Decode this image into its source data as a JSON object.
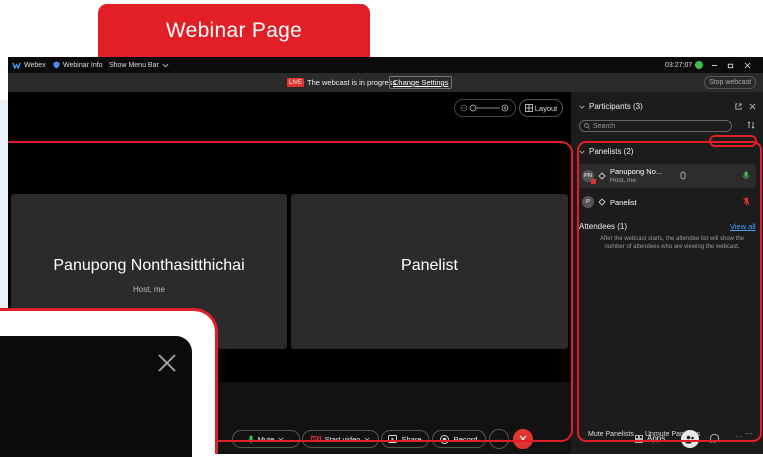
{
  "banner": {
    "title": "Webinar Page"
  },
  "titlebar": {
    "app_name": "Webex",
    "webinar_info": "Webinar Info",
    "show_menu_bar": "Show Menu Bar",
    "time": "03:27:07"
  },
  "infobar": {
    "live_badge": "LIVE",
    "status_text": "The webcast is in progress.",
    "change_settings": "Change Settings",
    "stop_webcast": "Stop webcast"
  },
  "stage": {
    "layout_label": "Layout",
    "tiles": [
      {
        "name": "Panupong Nonthasitthichai",
        "subtitle": "Host, me"
      },
      {
        "name": "Panelist",
        "subtitle": ""
      }
    ]
  },
  "panel": {
    "title": "Participants (3)",
    "search_placeholder": "Search",
    "panelists_header": "Panelists (2)",
    "panelists": [
      {
        "initials": "PN",
        "name": "Panupong No...",
        "role": "Host, me"
      },
      {
        "initials": "P",
        "name": "Panelist",
        "role": ""
      }
    ],
    "attendees_header": "Attendees (1)",
    "view_all": "View all",
    "attendees_note": "After the webcast starts, the attendee list will show the number of attendees who are viewing the webcast.",
    "mute_panelists": "Mute Panelists",
    "unmute_panelists": "Unmute Panelists"
  },
  "controls": {
    "mute": "Mute",
    "start_video": "Start video",
    "share": "Share",
    "record": "Record",
    "apps": "Apps"
  },
  "colors": {
    "accent_red": "#e21f26",
    "app_bg": "#121212",
    "mic_green": "#3fbf4f"
  }
}
